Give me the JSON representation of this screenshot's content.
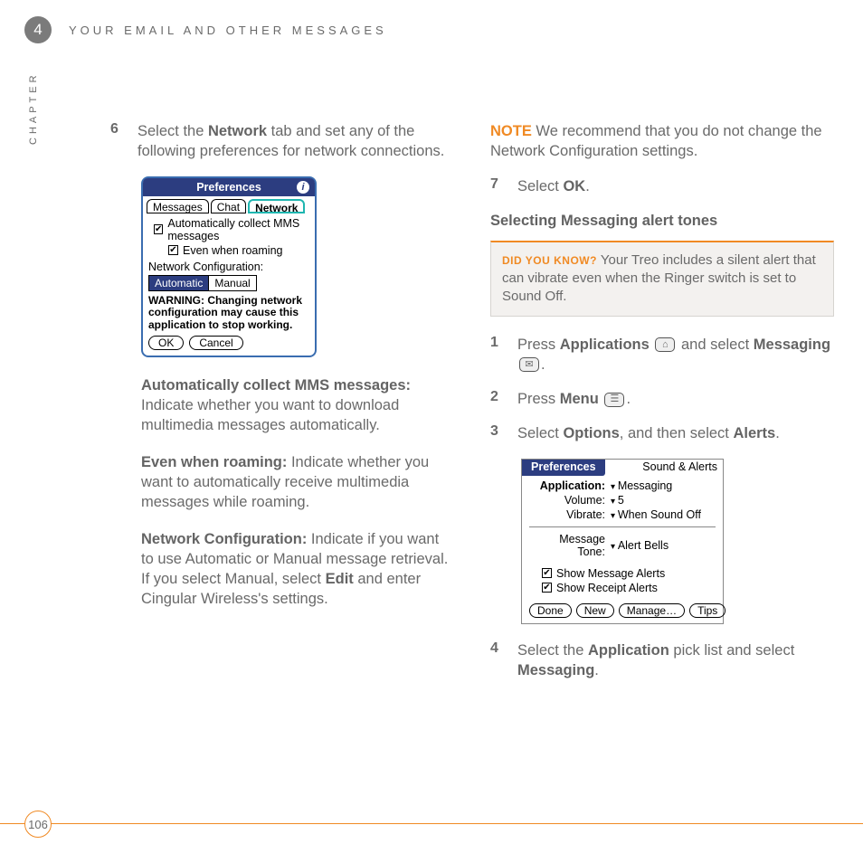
{
  "chapter": {
    "number": "4",
    "label": "CHAPTER",
    "title": "YOUR EMAIL AND OTHER MESSAGES"
  },
  "page_number": "106",
  "left": {
    "step6": {
      "num": "6",
      "pre": "Select the ",
      "bold1": "Network",
      "post": " tab and set any of the following preferences for network connections."
    },
    "palm1": {
      "title": "Preferences",
      "tabs": [
        "Messages",
        "Chat",
        "Network"
      ],
      "chk1": "Automatically collect MMS messages",
      "chk2": "Even when roaming",
      "netconf_label": "Network Configuration:",
      "seg": [
        "Automatic",
        "Manual"
      ],
      "warn": "WARNING: Changing network configuration may cause this application to stop working.",
      "btns": [
        "OK",
        "Cancel"
      ]
    },
    "para1": {
      "bold": "Automatically collect MMS messages:",
      "rest": " Indicate whether you want to download multimedia messages automatically."
    },
    "para2": {
      "bold": "Even when roaming:",
      "rest": " Indicate whether you want to automatically receive multimedia messages while roaming."
    },
    "para3": {
      "bold1": "Network Configuration:",
      "mid": " Indicate if you want to use Automatic or Manual message retrieval. If you select Manual, select ",
      "bold2": "Edit",
      "end": " and enter Cingular Wireless's settings."
    }
  },
  "right": {
    "note": {
      "label": "NOTE",
      "text": " We recommend that you do not change the Network Configuration settings."
    },
    "step7": {
      "num": "7",
      "pre": "Select ",
      "bold": "OK",
      "post": "."
    },
    "subheading": "Selecting Messaging alert tones",
    "didyou": {
      "label": "DID YOU KNOW?",
      "text": " Your Treo includes a silent alert that can vibrate even when the Ringer switch is set to Sound Off."
    },
    "s1": {
      "num": "1",
      "a": "Press ",
      "b": "Applications",
      "c": " and select ",
      "d": "Messaging",
      "e": "."
    },
    "s2": {
      "num": "2",
      "a": "Press ",
      "b": "Menu",
      "c": "."
    },
    "s3": {
      "num": "3",
      "a": "Select ",
      "b": "Options",
      "c": ", and then select ",
      "d": "Alerts",
      "e": "."
    },
    "palm2": {
      "title_left": "Preferences",
      "title_right": "Sound & Alerts",
      "rows": {
        "app": {
          "label": "Application:",
          "value": "Messaging"
        },
        "vol": {
          "label": "Volume:",
          "value": "5"
        },
        "vib": {
          "label": "Vibrate:",
          "value": "When Sound Off"
        },
        "tone": {
          "label": "Message Tone:",
          "value": "Alert Bells"
        }
      },
      "chk1": "Show Message Alerts",
      "chk2": "Show Receipt Alerts",
      "btns": [
        "Done",
        "New",
        "Manage…",
        "Tips"
      ]
    },
    "s4": {
      "num": "4",
      "a": "Select the ",
      "b": "Application",
      "c": " pick list and select ",
      "d": "Messaging",
      "e": "."
    }
  },
  "icons": {
    "home": "⌂",
    "messaging": "✉",
    "menu": "☰"
  }
}
